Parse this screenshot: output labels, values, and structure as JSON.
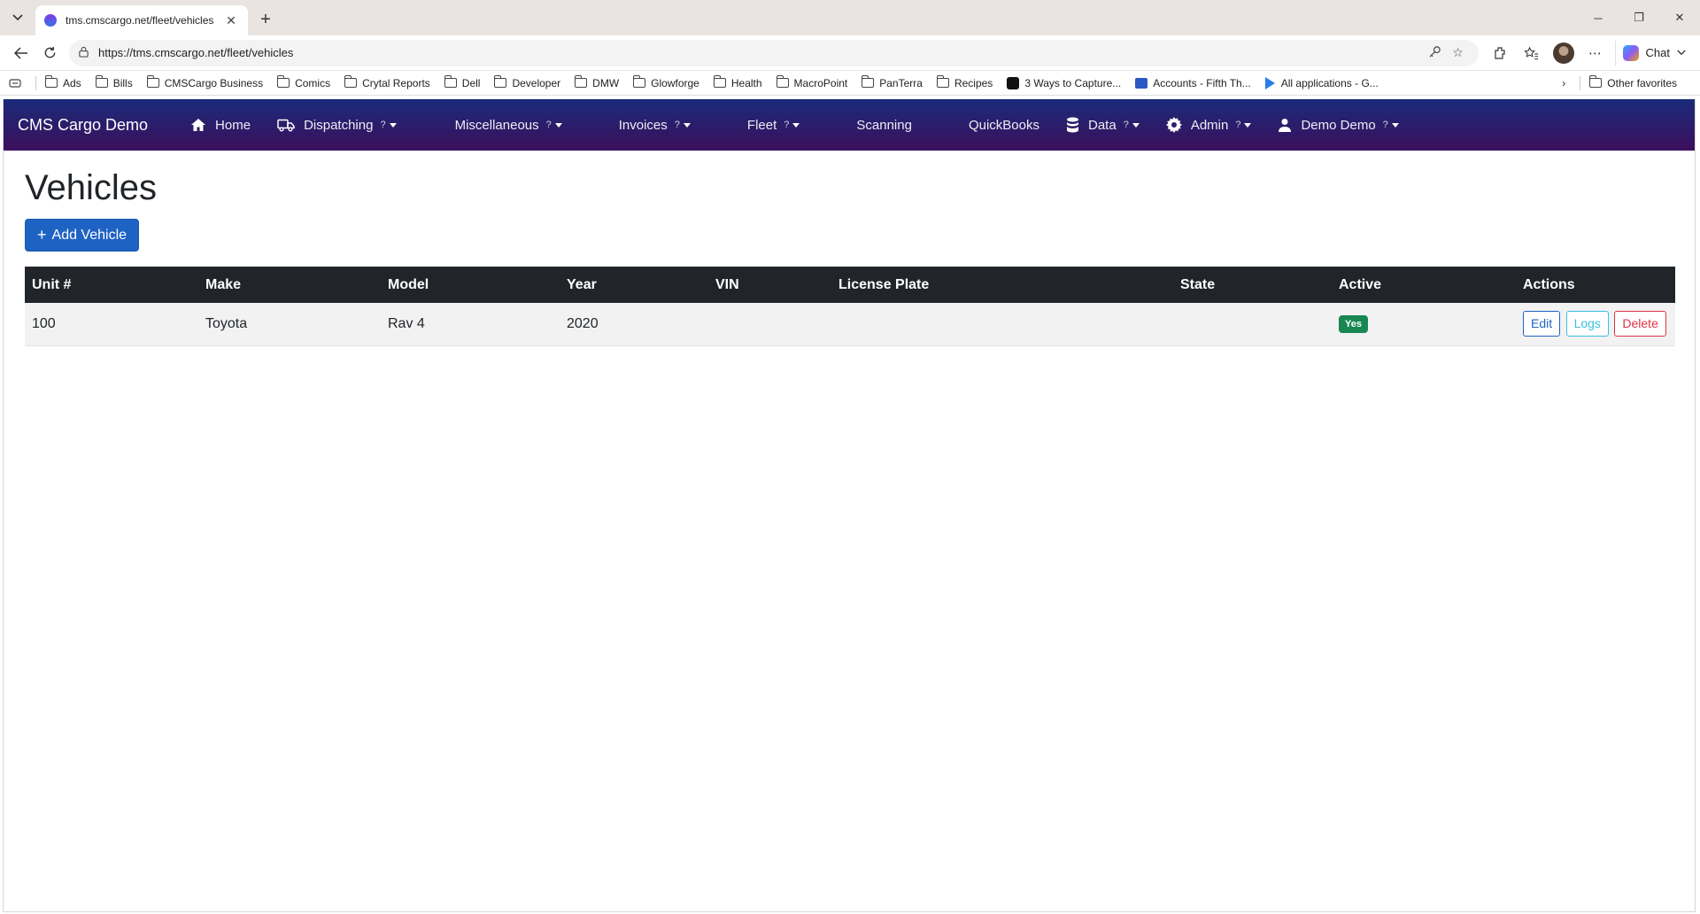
{
  "browser": {
    "tab_title": "tms.cmscargo.net/fleet/vehicles",
    "url": "https://tms.cmscargo.net/fleet/vehicles",
    "chat_label": "Chat",
    "bookmarks": [
      "Ads",
      "Bills",
      "CMSCargo Business",
      "Comics",
      "Crytal Reports",
      "Dell",
      "Developer",
      "DMW",
      "Glowforge",
      "Health",
      "MacroPoint",
      "PanTerra",
      "Recipes"
    ],
    "bookmark_3ways": "3 Ways to Capture...",
    "bookmark_accounts": "Accounts - Fifth Th...",
    "bookmark_allapps": "All applications - G...",
    "other_favorites": "Other favorites"
  },
  "navbar": {
    "brand": "CMS Cargo Demo",
    "home": "Home",
    "dispatching": "Dispatching",
    "miscellaneous": "Miscellaneous",
    "invoices": "Invoices",
    "fleet": "Fleet",
    "scanning": "Scanning",
    "quickbooks": "QuickBooks",
    "data": "Data",
    "admin": "Admin",
    "user": "Demo Demo",
    "help_mark": "?"
  },
  "page": {
    "title": "Vehicles",
    "add_button": "Add Vehicle"
  },
  "table": {
    "headers": [
      "Unit #",
      "Make",
      "Model",
      "Year",
      "VIN",
      "License Plate",
      "State",
      "Active",
      "Actions"
    ],
    "rows": [
      {
        "unit": "100",
        "make": "Toyota",
        "model": "Rav 4",
        "year": "2020",
        "vin": "",
        "plate": "",
        "state": "",
        "active": "Yes"
      }
    ],
    "actions": {
      "edit": "Edit",
      "logs": "Logs",
      "delete": "Delete"
    }
  }
}
